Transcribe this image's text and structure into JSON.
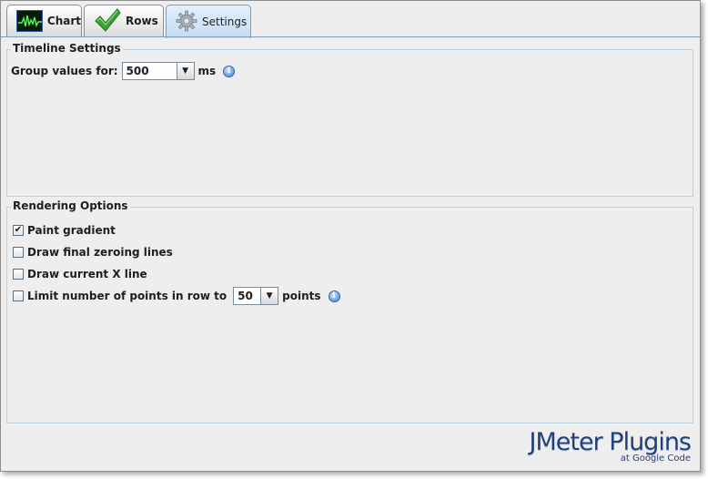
{
  "tabs": [
    {
      "label": "Chart",
      "icon": "chart-icon",
      "active": false
    },
    {
      "label": "Rows",
      "icon": "checkmark-icon",
      "active": false
    },
    {
      "label": "Settings",
      "icon": "gear-icon",
      "active": true
    }
  ],
  "timeline": {
    "title": "Timeline Settings",
    "group_label": "Group values for:",
    "group_value": "500",
    "group_unit": "ms",
    "info_glyph": "i"
  },
  "rendering": {
    "title": "Rendering Options",
    "options": [
      {
        "label": "Paint gradient",
        "checked": true
      },
      {
        "label": "Draw final zeroing lines",
        "checked": false
      },
      {
        "label": "Draw current X line",
        "checked": false
      },
      {
        "label": "Limit number of points in row to",
        "checked": false
      }
    ],
    "limit_value": "50",
    "limit_unit": "points",
    "check_glyph": "✔"
  },
  "branding": {
    "title": "JMeter Plugins",
    "subtitle": "at Google Code"
  },
  "colors": {
    "accent": "#7f9db9",
    "logo": "#23407a"
  }
}
